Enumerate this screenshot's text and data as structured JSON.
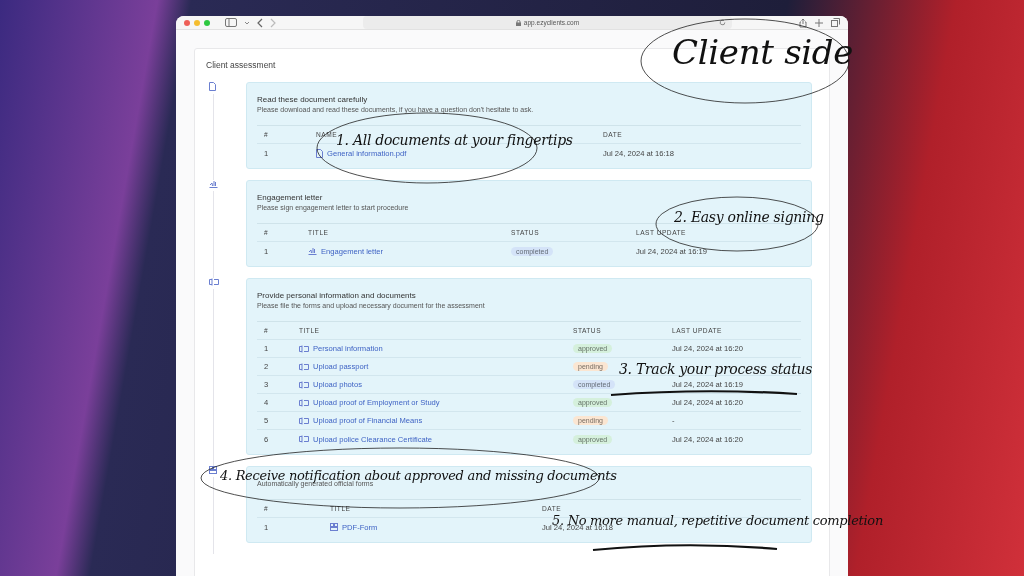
{
  "browser": {
    "url": "app.ezyclients.com"
  },
  "page": {
    "title": "Client assessment"
  },
  "sections": [
    {
      "kind": "documents",
      "title": "Read these document carefully",
      "subtitle": "Please download and read these documents, if you have a question don't hesitate to ask.",
      "columns": [
        "#",
        "NAME",
        "DATE"
      ],
      "rows": [
        {
          "number": "1",
          "title": "General information.pdf",
          "date": "Jul 24, 2024 at 16:18"
        }
      ]
    },
    {
      "kind": "signing",
      "title": "Engagement letter",
      "subtitle": "Please sign engagement letter to start procedure",
      "columns": [
        "#",
        "TITLE",
        "STATUS",
        "LAST UPDATE"
      ],
      "rows": [
        {
          "number": "1",
          "title": "Engagement letter",
          "status": "completed",
          "color": "#d4e3f8",
          "date": "Jul 24, 2024 at 16:19"
        }
      ]
    },
    {
      "kind": "forms",
      "title": "Provide personal information and documents",
      "subtitle": "Please file the forms and upload necessary document for the assessment",
      "columns": [
        "#",
        "TITLE",
        "STATUS",
        "LAST UPDATE"
      ],
      "rows": [
        {
          "number": "1",
          "title": "Personal information",
          "status": "approved",
          "color": "#d5f0dc",
          "date": "Jul 24, 2024 at 16:20"
        },
        {
          "number": "2",
          "title": "Upload passport",
          "status": "pending",
          "color": "#fbe6d2"
        },
        {
          "number": "3",
          "title": "Upload photos",
          "status": "completed",
          "color": "#d4e3f8",
          "date": "Jul 24, 2024 at 16:19"
        },
        {
          "number": "4",
          "title": "Upload proof of Employment or Study",
          "status": "approved",
          "color": "#d5f0dc",
          "date": "Jul 24, 2024 at 16:20"
        },
        {
          "number": "5",
          "title": "Upload proof of Financial Means",
          "status": "pending",
          "color": "#fbe6d2",
          "date": "-"
        },
        {
          "number": "6",
          "title": "Upload police Clearance Certificate",
          "status": "approved",
          "color": "#d5f0dc",
          "date": "Jul 24, 2024 at 16:20"
        }
      ]
    },
    {
      "kind": "generated",
      "subtitle": "Automatically generated official forms",
      "columns": [
        "#",
        "TITLE",
        "DATE"
      ],
      "rows": [
        {
          "number": "1",
          "title": "PDF-Form",
          "date": "Jul 24, 2024 at 16:18"
        }
      ]
    }
  ],
  "annotations": [
    {
      "kind": "oval",
      "text": "Client side"
    },
    {
      "kind": "oval",
      "text": "1. All documents at your fingertips"
    },
    {
      "kind": "oval",
      "text": "2. Easy online signing"
    },
    {
      "kind": "underline",
      "text": "3. Track your process status"
    },
    {
      "kind": "oval",
      "text": "4. Receive notification about approved and missing documents"
    },
    {
      "kind": "underline",
      "text": "5. No more manual, repetitive document completion"
    }
  ]
}
